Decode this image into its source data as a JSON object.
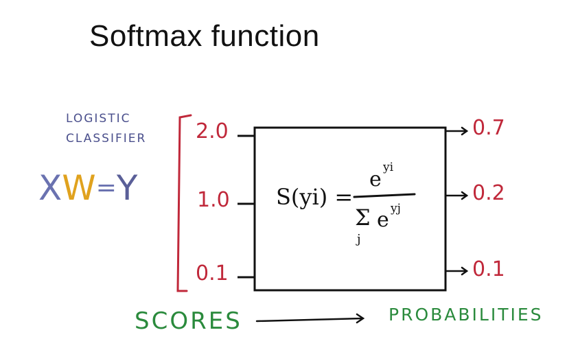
{
  "title": "Softmax function",
  "side_label": {
    "line1": "LOGISTIC",
    "line2": "CLASSIFIER"
  },
  "equation": {
    "x": "X",
    "w": "W",
    "eq": "=",
    "y": "Y"
  },
  "scores": [
    "2.0",
    "1.0",
    "0.1"
  ],
  "probabilities": [
    "0.7",
    "0.2",
    "0.1"
  ],
  "formula": {
    "lhs": "S(yi) =",
    "numerator_base": "e",
    "numerator_exp": "yi",
    "denominator_sum": "Σ",
    "denominator_index": "j",
    "denominator_base": "e",
    "denominator_exp": "yj"
  },
  "bottom": {
    "scores_label": "SCORES",
    "probabilities_label": "PROBABILITIES"
  },
  "colors": {
    "red": "#c0283a",
    "blue": "#4a4f8c",
    "green": "#2a8a3c",
    "x_color": "#6a72b0",
    "w_color": "#e0a21e",
    "y_color": "#5a5f98"
  }
}
